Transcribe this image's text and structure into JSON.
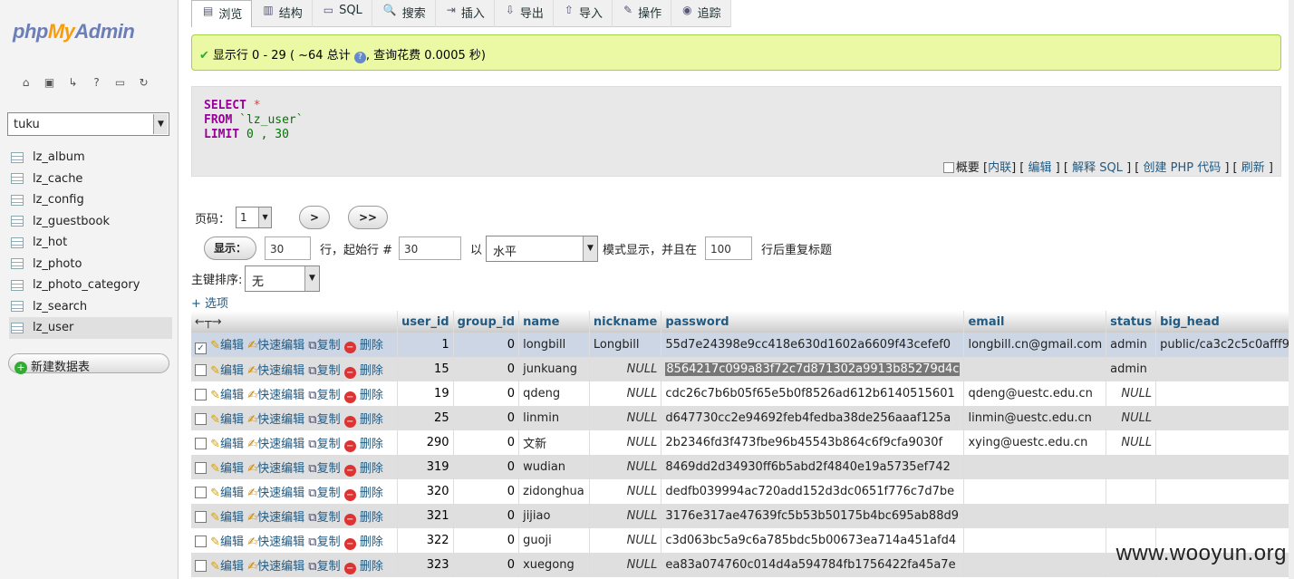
{
  "logo": {
    "php": "php",
    "my": "My",
    "admin": "Admin"
  },
  "db_select": {
    "value": "tuku"
  },
  "tables": [
    "lz_album",
    "lz_cache",
    "lz_config",
    "lz_guestbook",
    "lz_hot",
    "lz_photo",
    "lz_photo_category",
    "lz_search",
    "lz_user"
  ],
  "new_table": "新建数据表",
  "tabs": [
    {
      "label": "浏览",
      "icon": "browse-icon"
    },
    {
      "label": "结构",
      "icon": "structure-icon"
    },
    {
      "label": "SQL",
      "icon": "sql-icon"
    },
    {
      "label": "搜索",
      "icon": "search-icon"
    },
    {
      "label": "插入",
      "icon": "insert-icon"
    },
    {
      "label": "导出",
      "icon": "export-icon"
    },
    {
      "label": "导入",
      "icon": "import-icon"
    },
    {
      "label": "操作",
      "icon": "operations-icon"
    },
    {
      "label": "追踪",
      "icon": "tracking-icon"
    }
  ],
  "success": {
    "text1": "显示行 0 - 29 ( ~64 总计",
    "text2": ", 查询花费 0.0005 秒)"
  },
  "sql": {
    "select": "SELECT",
    "star": "*",
    "from": "FROM",
    "table": "`lz_user`",
    "limit": "LIMIT",
    "limit_vals": "0 , 30"
  },
  "sql_links": {
    "profile": "概要",
    "inline": "内联",
    "edit": "编辑",
    "explain": "解释 SQL",
    "php": "创建 PHP 代码",
    "refresh": "刷新"
  },
  "pager": {
    "label": "页码：",
    "page": "1",
    "next": ">",
    "last": ">>"
  },
  "display": {
    "button": "显示：",
    "rows": "30",
    "rows_label": "行，起始行 #",
    "start": "30",
    "mode_label": "以",
    "mode": "水平",
    "mode_suffix": "模式显示，并且在",
    "repeat": "100",
    "repeat_suffix": "行后重复标题"
  },
  "sort": {
    "label": "主键排序:",
    "value": "无"
  },
  "options_link": "+ 选项",
  "headers": [
    "user_id",
    "group_id",
    "name",
    "nickname",
    "password",
    "email",
    "status",
    "big_head"
  ],
  "actions": {
    "edit": "编辑",
    "quick_edit": "快速编辑",
    "copy": "复制",
    "delete": "删除"
  },
  "rows": [
    {
      "user_id": "1",
      "group_id": "0",
      "name": "longbill",
      "nickname": "Longbill",
      "password": "55d7e24398e9cc418e630d1602a6609f43cefef0",
      "email": "longbill.cn@gmail.com",
      "status": "admin",
      "big_head": "public/ca3c2c5c0afff9"
    },
    {
      "user_id": "15",
      "group_id": "0",
      "name": "junkuang",
      "nickname": "NULL",
      "password": "8564217c099a83f72c7d871302a9913b85279d4c",
      "email": "",
      "status": "admin",
      "big_head": ""
    },
    {
      "user_id": "19",
      "group_id": "0",
      "name": "qdeng",
      "nickname": "NULL",
      "password": "cdc26c7b6b05f65e5b0f8526ad612b6140515601",
      "email": "qdeng@uestc.edu.cn",
      "status": "NULL",
      "big_head": ""
    },
    {
      "user_id": "25",
      "group_id": "0",
      "name": "linmin",
      "nickname": "NULL",
      "password": "d647730cc2e94692feb4fedba38de256aaaf125a",
      "email": "linmin@uestc.edu.cn",
      "status": "NULL",
      "big_head": ""
    },
    {
      "user_id": "290",
      "group_id": "0",
      "name": "文新",
      "nickname": "NULL",
      "password": "2b2346fd3f473fbe96b45543b864c6f9cfa9030f",
      "email": "xying@uestc.edu.cn",
      "status": "NULL",
      "big_head": ""
    },
    {
      "user_id": "319",
      "group_id": "0",
      "name": "wudian",
      "nickname": "NULL",
      "password": "8469dd2d34930ff6b5abd2f4840e19a5735ef742",
      "email": "",
      "status": "",
      "big_head": ""
    },
    {
      "user_id": "320",
      "group_id": "0",
      "name": "zidonghua",
      "nickname": "NULL",
      "password": "dedfb039994ac720add152d3dc0651f776c7d7be",
      "email": "",
      "status": "",
      "big_head": ""
    },
    {
      "user_id": "321",
      "group_id": "0",
      "name": "jijiao",
      "nickname": "NULL",
      "password": "3176e317ae47639fc5b53b50175b4bc695ab88d9",
      "email": "",
      "status": "",
      "big_head": ""
    },
    {
      "user_id": "322",
      "group_id": "0",
      "name": "guoji",
      "nickname": "NULL",
      "password": "c3d063bc5a9c6a785bdc5b00673ea714a451afd4",
      "email": "",
      "status": "",
      "big_head": ""
    },
    {
      "user_id": "323",
      "group_id": "0",
      "name": "xuegong",
      "nickname": "NULL",
      "password": "ea83a074760c014d4a594784fb1756422fa45a7e",
      "email": "",
      "status": "",
      "big_head": ""
    }
  ],
  "watermark": "www.wooyun.org"
}
